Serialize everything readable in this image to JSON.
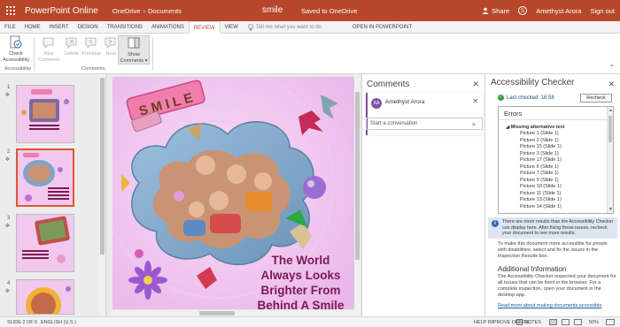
{
  "titlebar": {
    "app_name": "PowerPoint Online",
    "breadcrumb": [
      "OneDrive",
      "Documents"
    ],
    "breadcrumb_sep": "›",
    "doc_title": "smile",
    "doc_status": "Saved to OneDrive",
    "share_label": "Share",
    "user_name": "Amethyst Arora",
    "sign_out": "Sign out"
  },
  "tabs": [
    "FILE",
    "HOME",
    "INSERT",
    "DESIGN",
    "TRANSITIONS",
    "ANIMATIONS",
    "REVIEW",
    "VIEW"
  ],
  "active_tab": "REVIEW",
  "tell_me": "Tell me what you want to do",
  "open_in": "OPEN IN POWERPOINT",
  "ribbon": {
    "check_accessibility": [
      "Check",
      "Accessibility"
    ],
    "accessibility_group": "Accessibility",
    "new_comment": [
      "New",
      "Comment"
    ],
    "delete": "Delete",
    "previous": "Previous",
    "next": "Next",
    "show_comments": [
      "Show",
      "Comments ▾"
    ],
    "comments_group": "Comments"
  },
  "thumbnails": [
    {
      "num": "1",
      "star": "✲"
    },
    {
      "num": "2",
      "star": "✲"
    },
    {
      "num": "3",
      "star": "✲"
    },
    {
      "num": "4",
      "star": "✲"
    }
  ],
  "active_slide": 2,
  "slide": {
    "banner": "S M I L E",
    "text_lines": [
      "The World",
      "Always Looks",
      "Brighter From",
      "Behind A Smile"
    ]
  },
  "comments_pane": {
    "title": "Comments",
    "author": "Amethyst Arora",
    "author_initials": "AA",
    "placeholder": "Start a conversation"
  },
  "accessibility_pane": {
    "title": "Accessibility Checker",
    "last_checked": "Last checked: 16:58",
    "recheck": "Recheck",
    "errors_header": "Errors",
    "category": "Missing alternative text",
    "items": [
      "Picture 1 (Slide 1)",
      "Picture 2 (Slide 1)",
      "Picture 15 (Slide 1)",
      "Picture 3 (Slide 1)",
      "Picture 17 (Slide 1)",
      "Picture 6 (Slide 1)",
      "Picture 7 (Slide 1)",
      "Picture 9 (Slide 1)",
      "Picture 10 (Slide 1)",
      "Picture 11 (Slide 1)",
      "Picture 13 (Slide 1)",
      "Picture 14 (Slide 1)"
    ],
    "info": "There are more results than the Accessibility Checker can display here. After fixing these issues, recheck your document to see more results.",
    "make_accessible": "To make this document more accessible for people with disabilities, select and fix the issues in the Inspection Results box.",
    "additional_title": "Additional Information",
    "additional_text": "The Accessibility Checker inspected your document for all issues that can be fixed in the browser. For a complete inspection, open your document in the desktop app.",
    "read_more": "Read more about making documents accessible"
  },
  "statusbar": {
    "slide_count": "SLIDE 2 OF 5",
    "language": "ENGLISH (U.S.)",
    "help": "HELP IMPROVE OFFICE",
    "notes": "NOTES",
    "zoom": "50%"
  },
  "colors": {
    "brand": "#b7472a",
    "slide_bg": "#f3c8f2",
    "slide_text": "#7b1a52"
  }
}
